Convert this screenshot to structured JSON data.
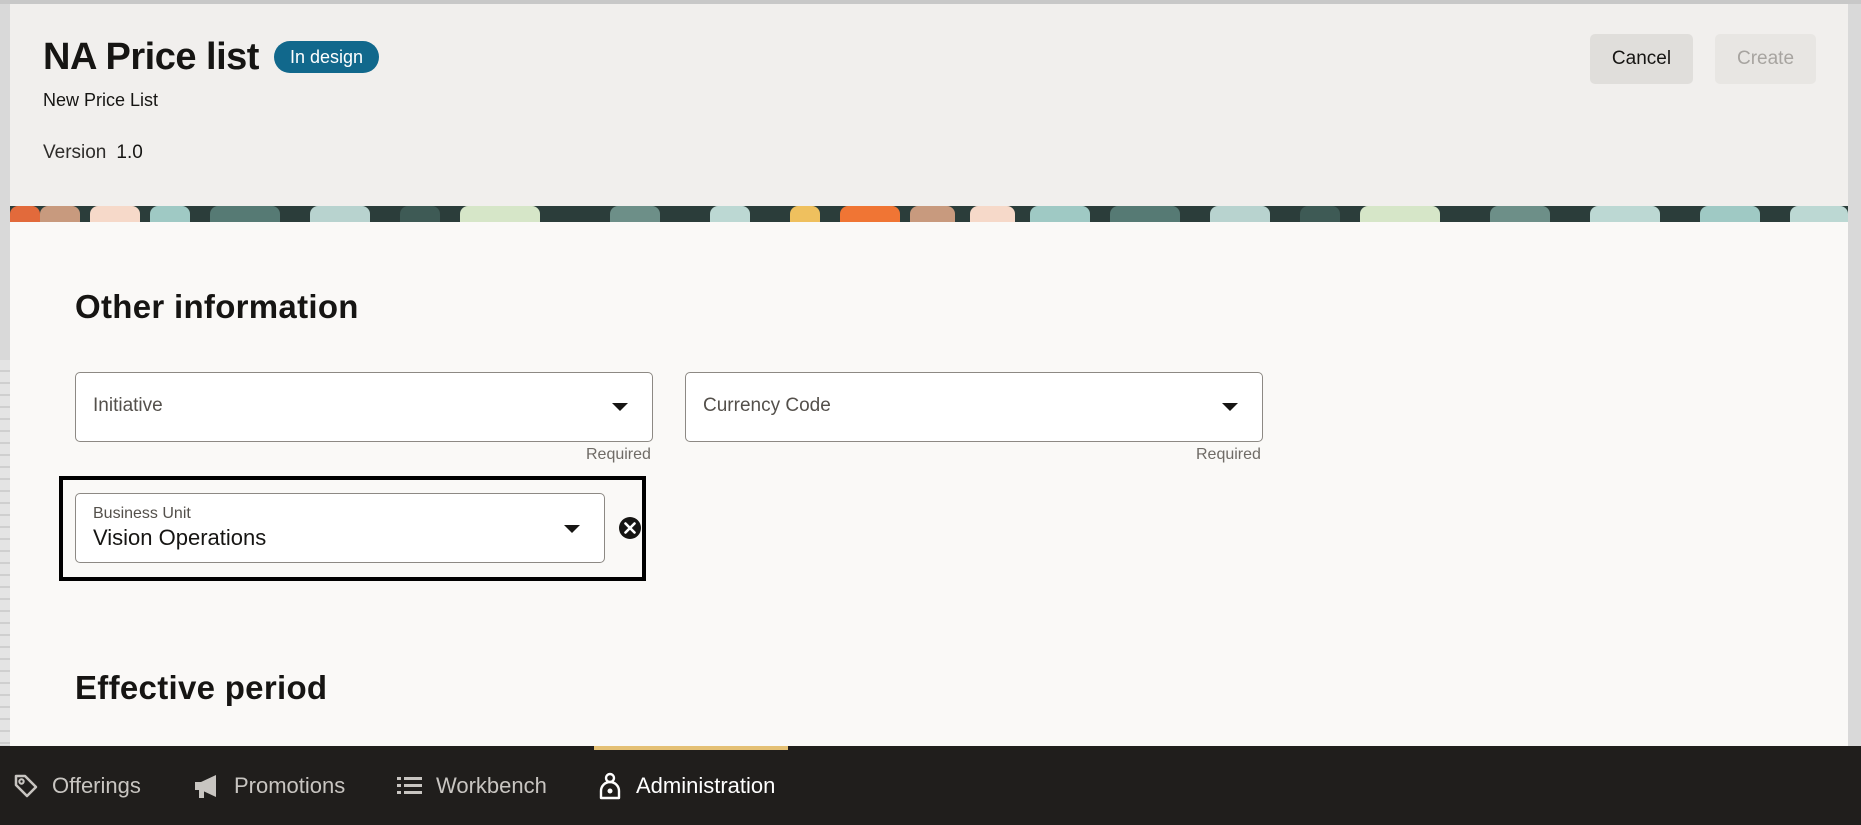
{
  "header": {
    "title": "NA Price list",
    "status_badge": "In design",
    "subtitle": "New Price List",
    "version_label": "Version",
    "version_value": "1.0",
    "cancel_label": "Cancel",
    "create_label": "Create"
  },
  "other_information": {
    "title": "Other information",
    "initiative": {
      "label": "Initiative",
      "helper": "Required"
    },
    "currency_code": {
      "label": "Currency Code",
      "helper": "Required"
    },
    "business_unit": {
      "label": "Business Unit",
      "value": "Vision Operations"
    }
  },
  "effective_period": {
    "title": "Effective period"
  },
  "bottom_nav": {
    "items": [
      {
        "label": "Offerings",
        "icon": "tag-icon",
        "active": false
      },
      {
        "label": "Promotions",
        "icon": "megaphone-icon",
        "active": false
      },
      {
        "label": "Workbench",
        "icon": "list-icon",
        "active": false
      },
      {
        "label": "Administration",
        "icon": "admin-icon",
        "active": true
      }
    ]
  },
  "colors": {
    "badge": "#11688c",
    "nav_bg": "#201e1c",
    "nav_active_indicator": "#e4c074",
    "header_bg": "#f1efed",
    "content_bg": "#faf9f7"
  }
}
